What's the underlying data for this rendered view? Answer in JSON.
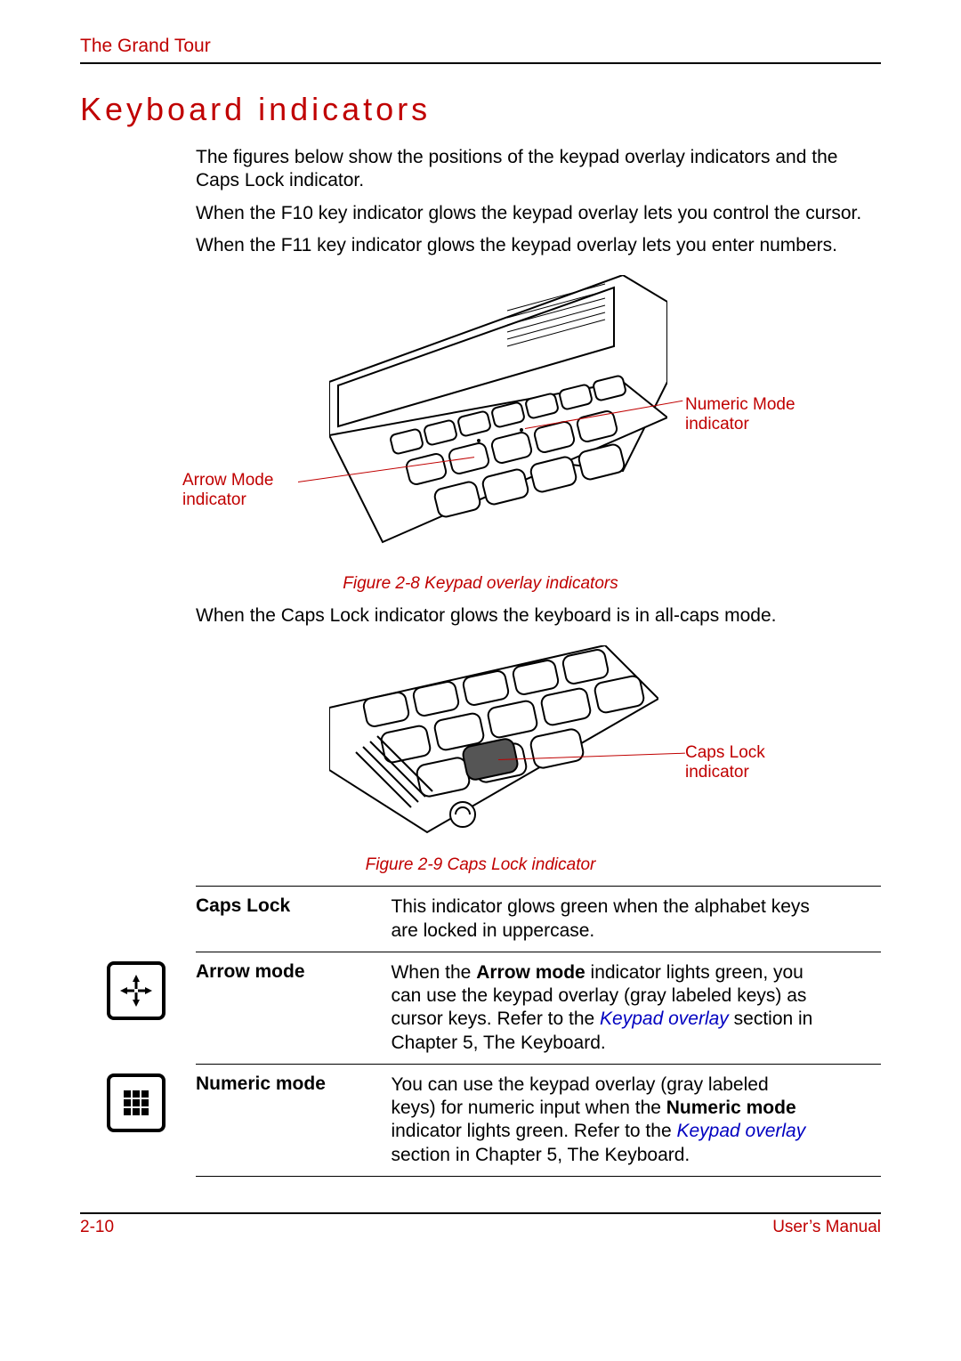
{
  "running_head": "The Grand Tour",
  "section_title": "Keyboard indicators",
  "intro": {
    "p1": "The figures below show the positions of the keypad overlay indicators and the Caps Lock indicator.",
    "p2": "When the F10 key indicator glows the keypad overlay lets you control the cursor.",
    "p3": "When the F11 key indicator glows the keypad overlay lets you enter numbers."
  },
  "figure1": {
    "caption": "Figure 2-8 Keypad overlay indicators",
    "callout_left": "Arrow Mode indicator",
    "callout_right": "Numeric Mode indicator"
  },
  "mid_text": "When the Caps Lock indicator glows the keyboard is in all-caps mode.",
  "figure2": {
    "caption": "Figure 2-9 Caps Lock indicator",
    "callout_right": "Caps Lock indicator"
  },
  "definitions": {
    "caps_lock": {
      "term": "Caps Lock",
      "desc": "This indicator glows green when the alphabet keys are locked in uppercase."
    },
    "arrow_mode": {
      "term": "Arrow mode",
      "desc_pre": "When the ",
      "desc_bold": "Arrow mode",
      "desc_mid": " indicator lights green, you can use the keypad overlay (gray labeled keys) as cursor keys. Refer to the ",
      "desc_xref": "Keypad overlay",
      "desc_post": " section in Chapter 5, The Keyboard."
    },
    "numeric_mode": {
      "term": "Numeric mode",
      "desc_pre": "You can use the keypad overlay (gray labeled keys) for numeric input when the ",
      "desc_bold": "Numeric mode",
      "desc_mid": " indicator lights green. Refer to the ",
      "desc_xref": "Keypad overlay",
      "desc_post": " section in Chapter 5, The Keyboard."
    }
  },
  "footer": {
    "left": "2-10",
    "right": "User’s Manual"
  }
}
